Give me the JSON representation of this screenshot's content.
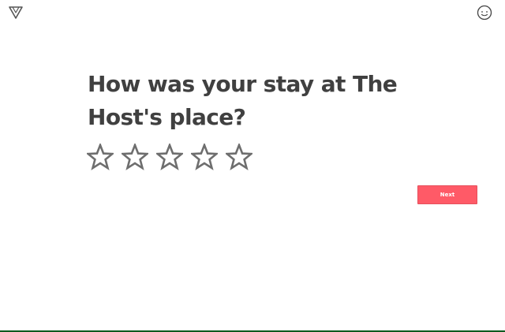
{
  "header": {
    "logo_icon": "triangle-logo-icon",
    "profile_icon": "smiley-face-icon"
  },
  "main": {
    "question": "How was your stay at The Host's place?",
    "rating": {
      "max_stars": 5,
      "selected": 0,
      "star_icon": "star-outline-icon",
      "star_color": "#6e6e6e"
    },
    "next_label": "Next"
  },
  "colors": {
    "accent": "#ff5a67",
    "text": "#404040",
    "bottom_bar": "#0e5a1f"
  }
}
